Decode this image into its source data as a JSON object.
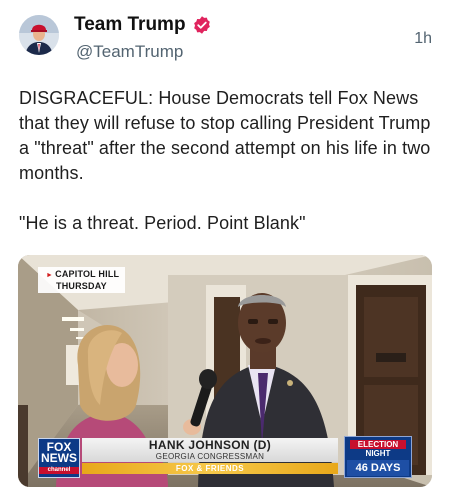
{
  "post": {
    "author_name": "Team Trump",
    "handle": "@TeamTrump",
    "timestamp": "1h",
    "verified_icon": "verified-badge-icon",
    "accent_color": "#e0245e",
    "text_paragraph_1": "DISGRACEFUL: House Democrats tell Fox News that they will refuse to stop calling President Trump a \"threat\" after the second attempt on his life in two months.",
    "text_paragraph_2": "\"He is a threat. Period. Point Blank\""
  },
  "media": {
    "location_bug_line1": "CAPITOL HILL",
    "location_bug_line2": "THURSDAY",
    "network_logo_line1": "FOX",
    "network_logo_line2": "NEWS",
    "network_logo_line3": "channel",
    "chyron_name": "HANK JOHNSON (D)",
    "chyron_title": "GEORGIA CONGRESSMAN",
    "show_name": "FOX & FRIENDS",
    "election_label_line1": "ELECTION",
    "election_label_line2": "NIGHT",
    "countdown": "46 DAYS"
  }
}
